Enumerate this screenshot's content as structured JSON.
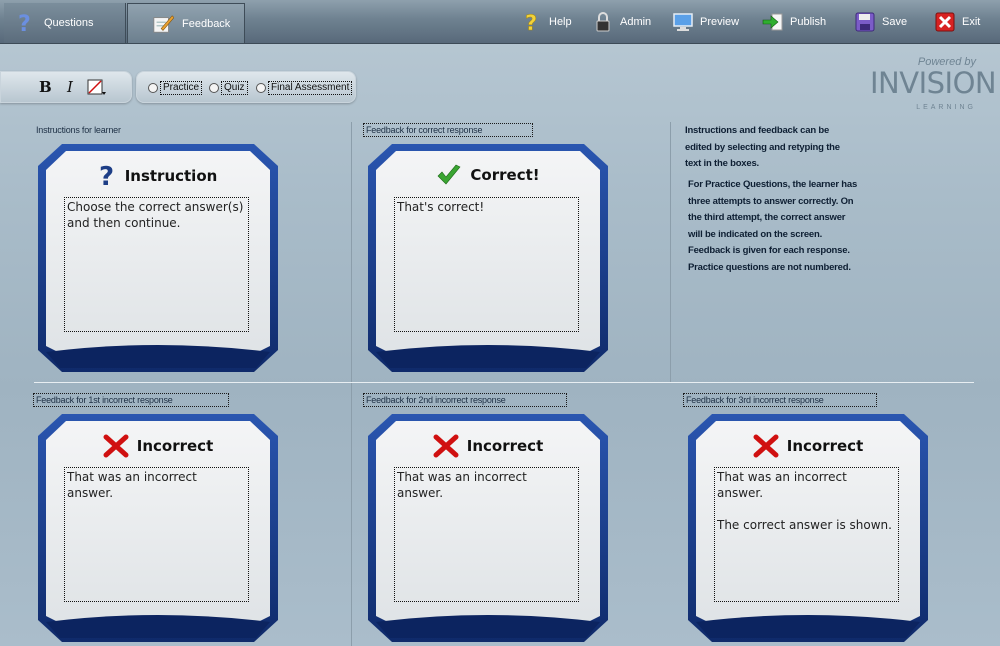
{
  "tabs": {
    "questions": "Questions",
    "feedback": "Feedback"
  },
  "toolbar": {
    "help": "Help",
    "admin": "Admin",
    "preview": "Preview",
    "publish": "Publish",
    "save": "Save",
    "exit": "Exit"
  },
  "format": {
    "bold": "B",
    "italic": "I"
  },
  "modes": {
    "practice": "Practice",
    "quiz": "Quiz",
    "final": "Final Assessment"
  },
  "logo": {
    "powered_by": "Powered by",
    "brand": "INVISION",
    "sub": "LEARNING"
  },
  "sections": {
    "instructions_label": "Instructions for learner",
    "correct_label": "Feedback for correct response",
    "incorrect1_label": "Feedback for 1st incorrect response",
    "incorrect2_label": "Feedback for 2nd incorrect response",
    "incorrect3_label": "Feedback for 3rd incorrect response"
  },
  "cards": {
    "instruction": {
      "title": "Instruction",
      "text": "Choose the correct answer(s)\nand then continue."
    },
    "correct": {
      "title": "Correct!",
      "text": "That's correct!"
    },
    "incorrect1": {
      "title": "Incorrect",
      "text": "That was an incorrect answer."
    },
    "incorrect2": {
      "title": "Incorrect",
      "text": "That was an incorrect answer."
    },
    "incorrect3": {
      "title": "Incorrect",
      "text": "That was an incorrect answer.\n\nThe correct answer is shown."
    }
  },
  "help": {
    "para1": [
      "Instructions and feedback can be",
      "edited by selecting and retyping the",
      "text  in the boxes."
    ],
    "para2": [
      "For Practice Questions, the learner has",
      "three attempts to answer correctly.  On",
      "the third attempt, the correct answer",
      "will be indicated on the screen.",
      "Feedback is given for each response.",
      "Practice questions are not numbered."
    ]
  },
  "colors": {
    "card_blue": "#1d3f8a",
    "card_inner": "#eceef0",
    "check_green": "#3aa532",
    "cross_red": "#d01010"
  }
}
